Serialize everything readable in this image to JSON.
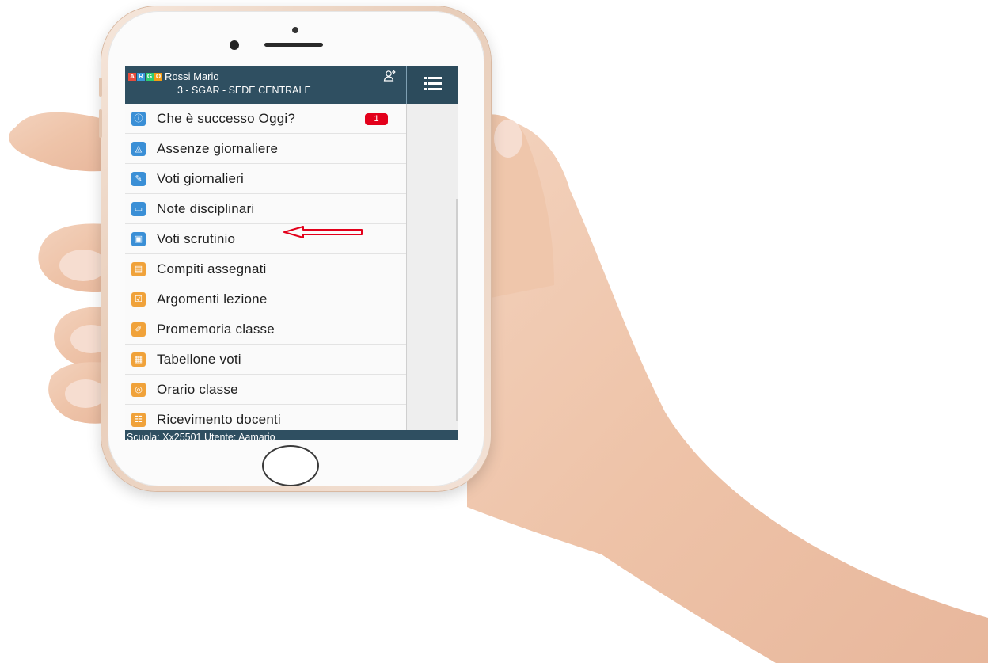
{
  "app": {
    "logo_letters": [
      "A",
      "R",
      "G",
      "O"
    ],
    "logo_colors": [
      "#e84b3c",
      "#3a9ad9",
      "#2ecc71",
      "#f39c12"
    ],
    "user_name": "Rossi Mario",
    "school_line": "3 - SGAR - SEDE CENTRALE",
    "menu_icon": "hamburger-icon",
    "header_color": "#2f4f61"
  },
  "menu": {
    "items": [
      {
        "label": "Che è successo Oggi?",
        "icon": "info-icon",
        "color": "#3a8fd6",
        "badge": "1"
      },
      {
        "label": "Assenze giornaliere",
        "icon": "absence-icon",
        "color": "#3a8fd6"
      },
      {
        "label": "Voti giornalieri",
        "icon": "grades-icon",
        "color": "#3a8fd6"
      },
      {
        "label": "Note disciplinari",
        "icon": "notes-icon",
        "color": "#3a8fd6"
      },
      {
        "label": "Voti scrutinio",
        "icon": "scrutiny-icon",
        "color": "#3a8fd6"
      },
      {
        "label": "Compiti assegnati",
        "icon": "homework-icon",
        "color": "#f0a23a"
      },
      {
        "label": "Argomenti lezione",
        "icon": "lesson-icon",
        "color": "#f0a23a"
      },
      {
        "label": "Promemoria classe",
        "icon": "reminder-icon",
        "color": "#f0a23a"
      },
      {
        "label": "Tabellone voti",
        "icon": "board-icon",
        "color": "#f0a23a"
      },
      {
        "label": "Orario classe",
        "icon": "schedule-icon",
        "color": "#f0a23a"
      },
      {
        "label": "Ricevimento docenti",
        "icon": "meeting-icon",
        "color": "#f0a23a"
      }
    ]
  },
  "footer": {
    "text": "Scuola: Xx25501 Utente: Aamario"
  },
  "annotation": {
    "arrow_color": "#e3001b"
  }
}
